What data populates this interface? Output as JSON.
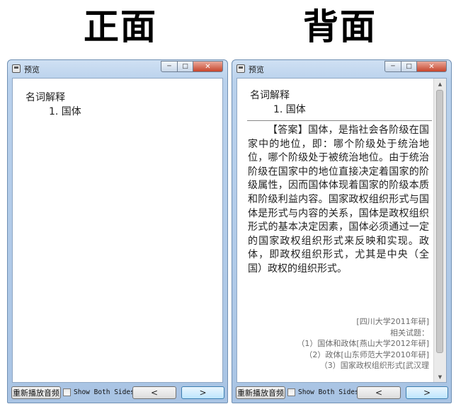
{
  "headings": {
    "front": "正面",
    "back": "背面"
  },
  "windows": {
    "title": "预览",
    "controls": {
      "minimize": "─",
      "maximize": "□",
      "close": "✕"
    }
  },
  "card": {
    "question_title": "名词解释",
    "question_item": "1. 国体",
    "answer": "【答案】国体，是指社会各阶级在国家中的地位，即：哪个阶级处于统治地位，哪个阶级处于被统治地位。由于统治阶级在国家中的地位直接决定着国家的阶级属性，因而国体体现着国家的阶级本质和阶级利益内容。国家政权组织形式与国体是形式与内容的关系，国体是政权组织形式的基本决定因素，国体必须通过一定的国家政权组织形式来反映和实现。政体，即政权组织形式，尤其是中央（全国）政权的组织形式。",
    "source": "[四川大学2011年研]",
    "related_heading": "相关试题：",
    "related": [
      "（1）国体和政体[燕山大学2012年研]",
      "（2）政体[山东师范大学2010年研]",
      "（3）国家政权组织形式[武汉理"
    ]
  },
  "bottom": {
    "replay_label": "重新播放音频",
    "show_both_label": "Show Both Sides",
    "prev_label": "<",
    "next_label": ">"
  },
  "icons": {
    "app": "app-icon",
    "scroll_up": "▲",
    "scroll_down": "▼"
  }
}
